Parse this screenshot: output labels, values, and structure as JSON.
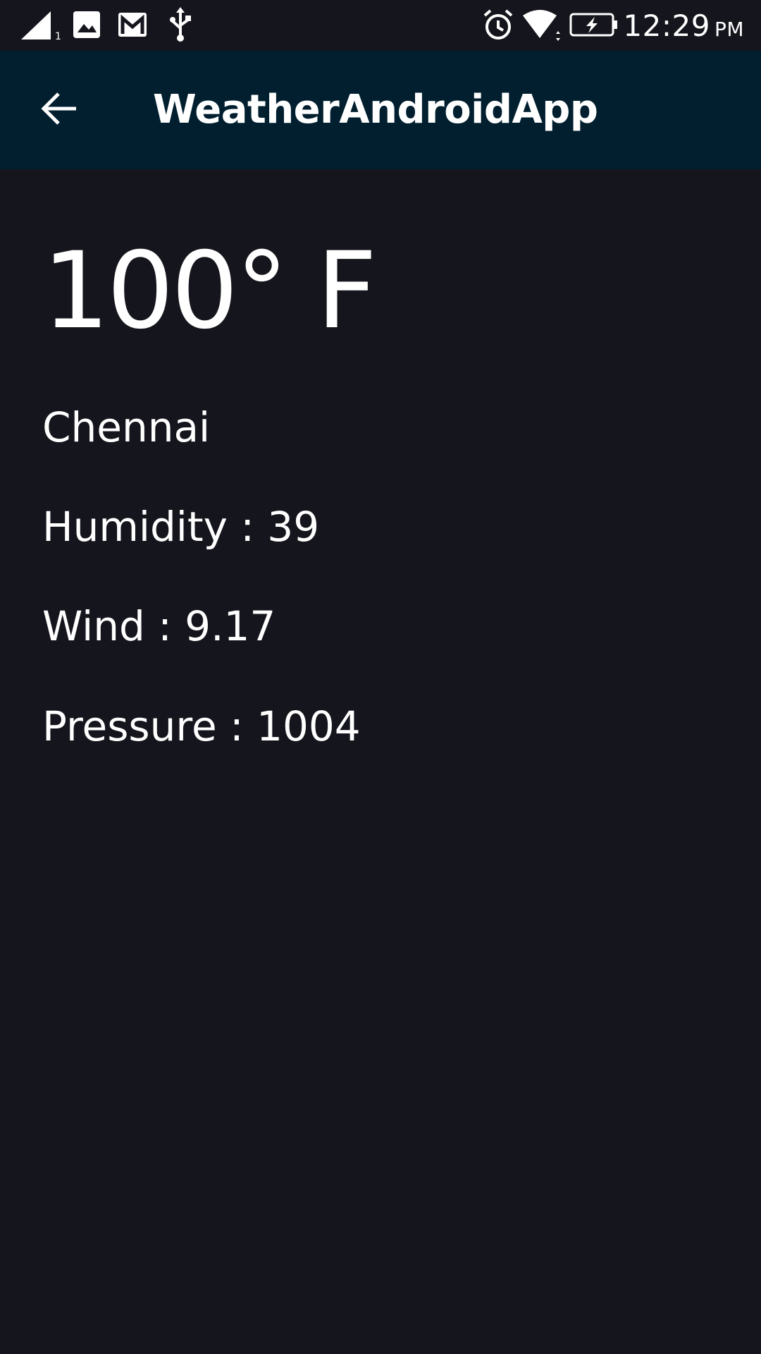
{
  "status_bar": {
    "time": "12:29",
    "ampm": "PM",
    "icons": [
      "signal-icon",
      "image-notification-icon",
      "gmail-icon",
      "usb-icon",
      "alarm-icon",
      "wifi-icon",
      "battery-charging-icon"
    ],
    "signal_sub": "1"
  },
  "app_bar": {
    "title": "WeatherAndroidApp",
    "background": "#011f2f",
    "back_icon": "back-arrow-icon"
  },
  "weather": {
    "temperature": "100° F",
    "city": "Chennai",
    "humidity": "Humidity : 39",
    "wind": "Wind : 9.17",
    "pressure": "Pressure : 1004"
  },
  "theme": {
    "background": "#15151d",
    "text": "#ffffff"
  }
}
